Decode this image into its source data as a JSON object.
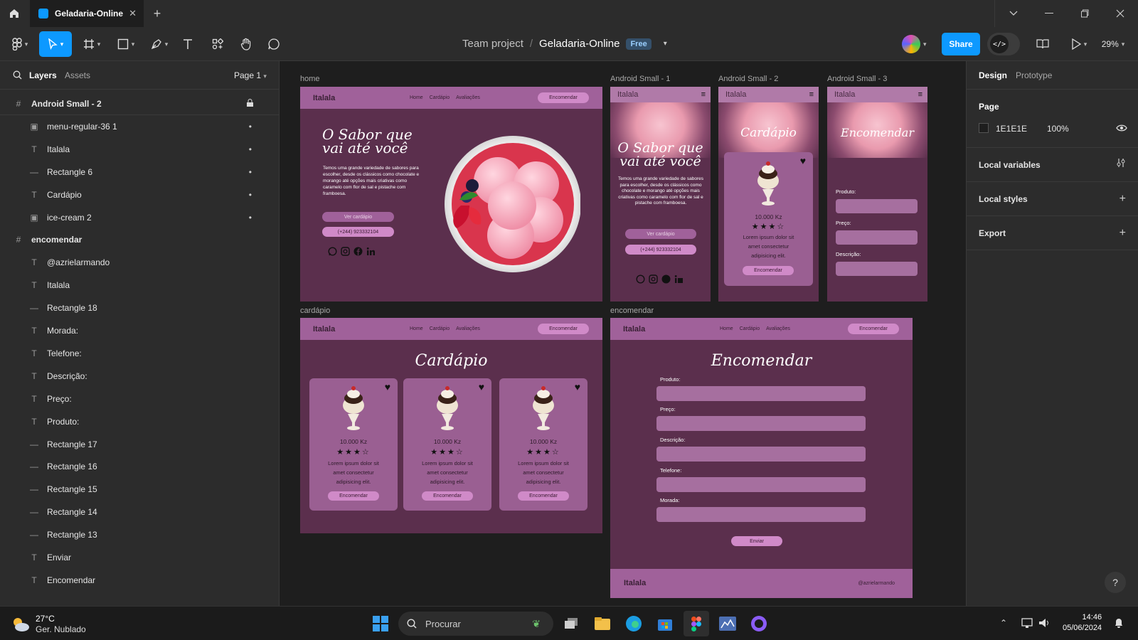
{
  "titlebar": {
    "tab_title": "Geladaria-Online",
    "tab_close": "✕",
    "new_tab": "+"
  },
  "toolbar": {
    "breadcrumb_project": "Team project",
    "breadcrumb_sep": "/",
    "file_name": "Geladaria-Online",
    "plan_badge": "Free",
    "share_label": "Share",
    "zoom": "29%"
  },
  "left_panel": {
    "tab_layers": "Layers",
    "tab_assets": "Assets",
    "page_selector": "Page 1",
    "layers": [
      {
        "label": "Android Small - 2",
        "type": "frame",
        "bold": true
      },
      {
        "label": "menu-regular-36 1",
        "type": "image"
      },
      {
        "label": "Italala",
        "type": "text"
      },
      {
        "label": "Rectangle 6",
        "type": "rect"
      },
      {
        "label": "Cardápio",
        "type": "text"
      },
      {
        "label": "ice-cream 2",
        "type": "image"
      },
      {
        "label": "encomendar",
        "type": "frame",
        "bold": true
      },
      {
        "label": "@azrielarmando",
        "type": "text"
      },
      {
        "label": "Italala",
        "type": "text"
      },
      {
        "label": "Rectangle 18",
        "type": "rect"
      },
      {
        "label": "Morada:",
        "type": "text"
      },
      {
        "label": "Telefone:",
        "type": "text"
      },
      {
        "label": "Descrição:",
        "type": "text"
      },
      {
        "label": "Preço:",
        "type": "text"
      },
      {
        "label": "Produto:",
        "type": "text"
      },
      {
        "label": "Rectangle 17",
        "type": "rect"
      },
      {
        "label": "Rectangle 16",
        "type": "rect"
      },
      {
        "label": "Rectangle 15",
        "type": "rect"
      },
      {
        "label": "Rectangle 14",
        "type": "rect"
      },
      {
        "label": "Rectangle 13",
        "type": "rect"
      },
      {
        "label": "Enviar",
        "type": "text"
      },
      {
        "label": "Encomendar",
        "type": "text"
      }
    ]
  },
  "right_panel": {
    "tab_design": "Design",
    "tab_prototype": "Prototype",
    "page_heading": "Page",
    "page_color": "1E1E1E",
    "page_opacity": "100%",
    "local_variables": "Local variables",
    "local_styles": "Local styles",
    "export": "Export",
    "help": "?"
  },
  "canvas": {
    "frame_labels": {
      "home": "home",
      "android1": "Android Small - 1",
      "android2": "Android Small - 2",
      "android3": "Android Small - 3",
      "cardapio": "cardápio",
      "encomendar": "encomendar"
    },
    "site": {
      "logo": "Italala",
      "nav_home": "Home",
      "nav_cardapio": "Cardápio",
      "nav_avaliacoes": "Avaliações",
      "order_button": "Encomendar",
      "hero_title_line1": "O Sabor que",
      "hero_title_line2": "vai até você",
      "hero_text": "Temos uma grande variedade de sabores para escolher, desde os clássicos como chocolate e morango até opções mais criativas como caramelo com flor de sal e pistache com framboesa.",
      "btn_cardapio": "Ver cardápio",
      "btn_phone": "(+244) 923332104",
      "cardapio_title": "Cardápio",
      "encomendar_title": "Encomendar",
      "price": "10.000 Kz",
      "stars": "★★★☆",
      "lorem": "Lorem ipsum dolor sit amet consectetur adipisicing elit.",
      "card_button": "Encomendar",
      "field_produto": "Produto:",
      "field_preco": "Preço:",
      "field_descricao": "Descrição:",
      "field_telefone": "Telefone:",
      "field_morada": "Morada:",
      "send_button": "Enviar",
      "footer_handle": "@azrielarmando",
      "menu_icon": "≡"
    }
  },
  "taskbar": {
    "weather_temp": "27°C",
    "weather_desc": "Ger. Nublado",
    "search_placeholder": "Procurar",
    "time": "14:46",
    "date": "05/06/2024"
  },
  "colors": {
    "accent_blue": "#0d99ff",
    "frame_bg": "#5b2f4d",
    "nav_bg": "#a0619a",
    "pill": "#d08ac8"
  }
}
